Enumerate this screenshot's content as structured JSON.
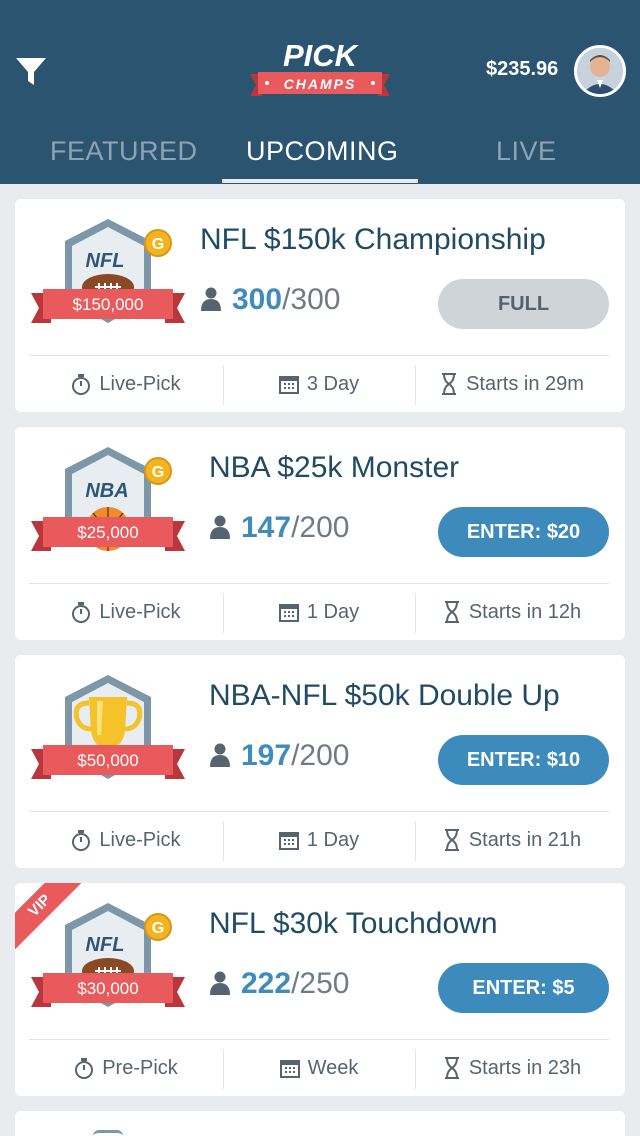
{
  "header": {
    "logo_top": "PICK",
    "logo_bottom": "CHAMPS",
    "balance": "$235.96"
  },
  "tabs": [
    {
      "label": "FEATURED",
      "active": false
    },
    {
      "label": "UPCOMING",
      "active": true
    },
    {
      "label": "LIVE",
      "active": false
    }
  ],
  "contests": [
    {
      "title": "NFL $150k Championship",
      "badge_league": "NFL",
      "badge_prize": "$150,000",
      "entries_current": "300",
      "entries_max": "/300",
      "button": "FULL",
      "type": "Live-Pick",
      "duration": "3 Day",
      "starts": "Starts in 29m"
    },
    {
      "title": "NBA $25k Monster",
      "badge_league": "NBA",
      "badge_prize": "$25,000",
      "entries_current": "147",
      "entries_max": "/200",
      "button": "ENTER: $20",
      "type": "Live-Pick",
      "duration": "1 Day",
      "starts": "Starts in 12h"
    },
    {
      "title": "NBA-NFL $50k Double Up",
      "badge_league": "",
      "badge_prize": "$50,000",
      "entries_current": "197",
      "entries_max": "/200",
      "button": "ENTER: $10",
      "type": "Live-Pick",
      "duration": "1 Day",
      "starts": "Starts in 21h"
    },
    {
      "title": "NFL $30k Touchdown",
      "badge_league": "NFL",
      "badge_prize": "$30,000",
      "ribbon": "VIP",
      "entries_current": "222",
      "entries_max": "/250",
      "button": "ENTER: $5",
      "type": "Pre-Pick",
      "duration": "Week",
      "starts": "Starts in 23h"
    }
  ],
  "colors": {
    "header_bg": "#2b5470",
    "accent_blue": "#3c8bbc",
    "ribbon_red": "#e85a5c",
    "gold": "#f2b51f"
  },
  "icons": [
    "filter-icon",
    "person-icon",
    "stopwatch-icon",
    "calendar-icon",
    "hourglass-icon",
    "gold-coin-icon",
    "football-icon",
    "basketball-icon",
    "trophy-icon"
  ]
}
